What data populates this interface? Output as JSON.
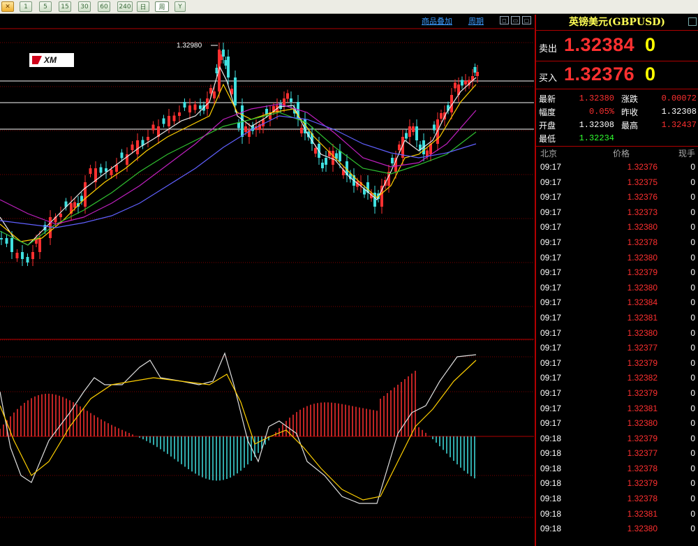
{
  "toolbar": {
    "buttons": [
      "1",
      "5",
      "15",
      "30",
      "60",
      "240",
      "日",
      "周",
      "Y"
    ],
    "active_index": 6
  },
  "chart_header": {
    "overlay_label": "商品叠加",
    "period_label": "周期"
  },
  "chart": {
    "logo_text": "XM",
    "annotation_high": "1.32980",
    "colors": {
      "up_candle": "#ff3030",
      "down_candle": "#40e0e0",
      "ma_white": "#e8e8e8",
      "ma_yellow": "#ffd000",
      "ma_green": "#30c030",
      "ma_purple": "#c020c0",
      "ma_blue": "#6060ff",
      "grid": "#800000",
      "level_line": "#c8c8c8"
    },
    "icons": [
      "close-icon",
      "minimize-icon",
      "window-icon"
    ]
  },
  "chart_data": [
    {
      "type": "line",
      "title": "",
      "annotations": [
        "1.32980"
      ],
      "note": "Candlestick chart with five moving averages; high marked at 1.32980"
    },
    {
      "type": "bar",
      "title": "",
      "note": "MACD histogram with two signal lines"
    }
  ],
  "panel": {
    "title": "英镑美元(GBPUSD)",
    "sell_label": "卖出",
    "sell_price": "1.32384",
    "sell_vol": "0",
    "buy_label": "买入",
    "buy_price": "1.32376",
    "buy_vol": "0",
    "stats": {
      "latest_label": "最新",
      "latest": "1.32380",
      "change_label": "涨跌",
      "change": "0.00072",
      "range_label": "幅度",
      "range": "0.05%",
      "prev_label": "昨收",
      "prev": "1.32308",
      "open_label": "开盘",
      "open": "1.32308",
      "high_label": "最高",
      "high": "1.32437",
      "low_label": "最低",
      "low": "1.32234"
    },
    "tick_headers": {
      "time": "北京",
      "price": "价格",
      "vol": "现手"
    },
    "ticks": [
      {
        "time": "09:17",
        "price": "1.32376",
        "vol": "0"
      },
      {
        "time": "09:17",
        "price": "1.32375",
        "vol": "0"
      },
      {
        "time": "09:17",
        "price": "1.32376",
        "vol": "0"
      },
      {
        "time": "09:17",
        "price": "1.32373",
        "vol": "0"
      },
      {
        "time": "09:17",
        "price": "1.32380",
        "vol": "0"
      },
      {
        "time": "09:17",
        "price": "1.32378",
        "vol": "0"
      },
      {
        "time": "09:17",
        "price": "1.32380",
        "vol": "0"
      },
      {
        "time": "09:17",
        "price": "1.32379",
        "vol": "0"
      },
      {
        "time": "09:17",
        "price": "1.32380",
        "vol": "0"
      },
      {
        "time": "09:17",
        "price": "1.32384",
        "vol": "0"
      },
      {
        "time": "09:17",
        "price": "1.32381",
        "vol": "0"
      },
      {
        "time": "09:17",
        "price": "1.32380",
        "vol": "0"
      },
      {
        "time": "09:17",
        "price": "1.32377",
        "vol": "0"
      },
      {
        "time": "09:17",
        "price": "1.32379",
        "vol": "0"
      },
      {
        "time": "09:17",
        "price": "1.32382",
        "vol": "0"
      },
      {
        "time": "09:17",
        "price": "1.32379",
        "vol": "0"
      },
      {
        "time": "09:17",
        "price": "1.32381",
        "vol": "0"
      },
      {
        "time": "09:17",
        "price": "1.32380",
        "vol": "0"
      },
      {
        "time": "09:18",
        "price": "1.32379",
        "vol": "0"
      },
      {
        "time": "09:18",
        "price": "1.32377",
        "vol": "0"
      },
      {
        "time": "09:18",
        "price": "1.32378",
        "vol": "0"
      },
      {
        "time": "09:18",
        "price": "1.32379",
        "vol": "0"
      },
      {
        "time": "09:18",
        "price": "1.32378",
        "vol": "0"
      },
      {
        "time": "09:18",
        "price": "1.32381",
        "vol": "0"
      },
      {
        "time": "09:18",
        "price": "1.32380",
        "vol": "0"
      }
    ]
  }
}
